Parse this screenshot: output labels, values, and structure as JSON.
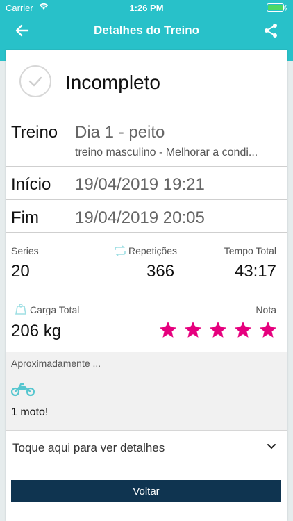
{
  "status_bar": {
    "carrier": "Carrier",
    "time": "1:26 PM"
  },
  "header": {
    "title": "Detalhes do Treino",
    "back_icon": "back-arrow-icon",
    "share_icon": "share-icon"
  },
  "workout": {
    "status": "Incompleto",
    "treino_label": "Treino",
    "treino_name": "Dia 1 - peito",
    "treino_subtitle": "treino masculino - Melhorar a condi...",
    "inicio_label": "Início",
    "inicio_value": "19/04/2019 19:21",
    "fim_label": "Fim",
    "fim_value": "19/04/2019 20:05"
  },
  "stats": {
    "series_label": "Series",
    "series_value": "20",
    "reps_label": "Repetições",
    "reps_value": "366",
    "tempo_label": "Tempo Total",
    "tempo_value": "43:17",
    "carga_label": "Carga Total",
    "carga_value": "206 kg",
    "nota_label": "Nota",
    "nota_stars": 5,
    "star_color": "#e6007e"
  },
  "approx": {
    "title": "Aproximadamente ...",
    "value": "1 moto!"
  },
  "details": {
    "label": "Toque aqui para ver detalhes"
  },
  "actions": {
    "voltar": "Voltar"
  },
  "colors": {
    "header": "#28c1c9",
    "button": "#0f3450",
    "accent_icon": "#56c6cf"
  }
}
